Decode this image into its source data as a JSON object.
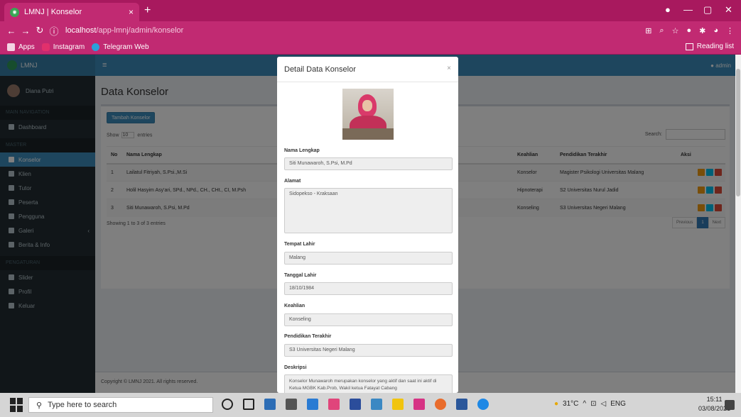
{
  "browser": {
    "tab_title": "LMNJ | Konselor",
    "tab_close": "×",
    "new_tab": "+",
    "url_host": "localhost",
    "url_path": "/app-lmnj/admin/konselor",
    "bookmarks": [
      "Apps",
      "Instagram",
      "Telegram Web"
    ],
    "reading_list": "Reading list"
  },
  "app": {
    "logo": "LMNJ",
    "user_name": "Diana Putri",
    "admin_label": "admin",
    "section_main": "MAIN NAVIGATION",
    "section_master": "MASTER",
    "section_settings": "PENGATURAN",
    "menu_main": [
      "Dashboard"
    ],
    "menu_master": [
      "Konselor",
      "Klien",
      "Tutor",
      "Peserta",
      "Pengguna",
      "Galeri",
      "Berita & Info"
    ],
    "menu_settings": [
      "Slider",
      "Profil",
      "Keluar"
    ],
    "page_title": "Data Konselor",
    "add_button": "Tambah Konselor",
    "show_label": "Show",
    "show_value": "10",
    "entries_label": "entries",
    "search_label": "Search:",
    "table": {
      "headers": [
        "No",
        "Nama Lengkap",
        "Keahlian",
        "Pendidikan Terakhir",
        "Aksi"
      ],
      "rows": [
        [
          "1",
          "Lailatul Fitriyah, S.Psi.,M.Si",
          "Konselor",
          "Magister Psikologi Universitas Malang"
        ],
        [
          "2",
          "Holil Hasyim Asy'ari, SPd., NPd., CH., CHt., CI, M.Psh",
          "Hipnoterapi",
          "S2 Universitas Nurul Jadid"
        ],
        [
          "3",
          "Siti Munawaroh, S.Psi, M.Pd",
          "Konseling",
          "S3 Universitas Negeri Malang"
        ]
      ]
    },
    "showing_info": "Showing 1 to 3 of 3 entries",
    "pager": [
      "Previous",
      "1",
      "Next"
    ],
    "footer": "Copyright © LMNJ 2021. All rights reserved."
  },
  "modal": {
    "title": "Detail Data Konselor",
    "close": "×",
    "fields": {
      "nama_label": "Nama Lengkap",
      "nama_value": "Siti Munawaroh, S.Psi, M.Pd",
      "alamat_label": "Alamat",
      "alamat_value": "Sidopekso - Kraksaan",
      "tempat_label": "Tempat Lahir",
      "tempat_value": "Malang",
      "tanggal_label": "Tanggal Lahir",
      "tanggal_value": "18/10/1984",
      "keahlian_label": "Keahlian",
      "keahlian_value": "Konseling",
      "pendidikan_label": "Pendidikan Terakhir",
      "pendidikan_value": "S3 Universitas Negeri Malang",
      "deskripsi_label": "Deskripsi",
      "deskripsi_value": "Konselor Munawaroh merupakan konselor yang aktif dan saat ini aktif di Ketua MGBK Kab.Prob, Wakil ketua Fatayat Cabang"
    }
  },
  "taskbar": {
    "search_placeholder": "Type here to search",
    "weather": "31°C",
    "lang": "ENG",
    "time": "15:11",
    "date": "03/08/2021"
  },
  "colors": {
    "browser_accent": "#c12a72",
    "admin_primary": "#3c8dbc",
    "sidebar_bg": "#222d32"
  }
}
